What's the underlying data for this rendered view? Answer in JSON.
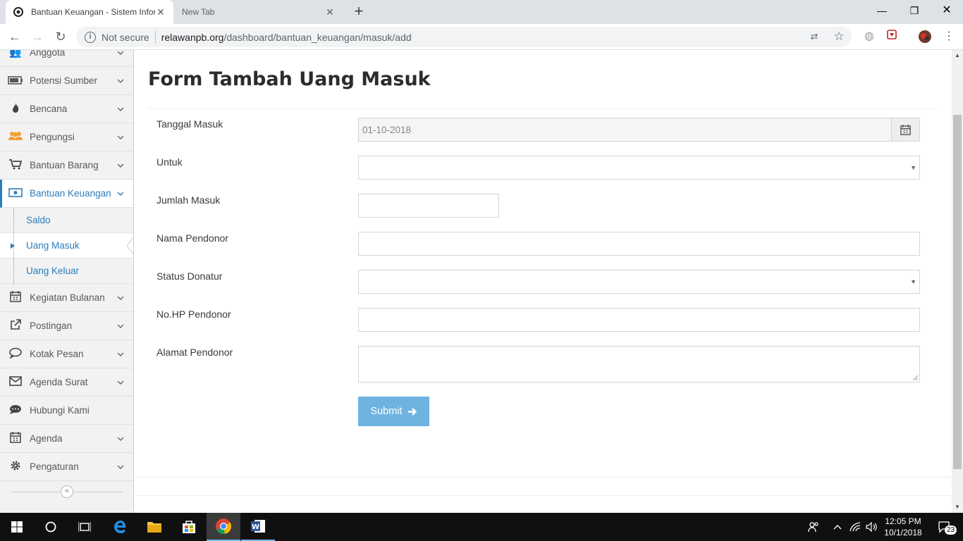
{
  "browser": {
    "tabs": [
      {
        "title": "Bantuan Keuangan - Sistem Infor",
        "active": true
      },
      {
        "title": "New Tab",
        "active": false
      }
    ],
    "security_label": "Not secure",
    "url_host": "relawanpb.org",
    "url_path": "/dashboard/bantuan_keuangan/masuk/add"
  },
  "sidebar": {
    "items": [
      {
        "label": "Anggota",
        "icon": "users-icon"
      },
      {
        "label": "Potensi Sumber",
        "icon": "battery-icon"
      },
      {
        "label": "Bencana",
        "icon": "fire-icon"
      },
      {
        "label": "Pengungsi",
        "icon": "group-icon"
      },
      {
        "label": "Bantuan Barang",
        "icon": "cart-icon"
      },
      {
        "label": "Bantuan Keuangan",
        "icon": "money-icon"
      },
      {
        "label": "Kegiatan Bulanan",
        "icon": "calendar-icon"
      },
      {
        "label": "Postingan",
        "icon": "external-link-icon"
      },
      {
        "label": "Kotak Pesan",
        "icon": "chat-icon"
      },
      {
        "label": "Agenda Surat",
        "icon": "envelope-icon"
      },
      {
        "label": "Hubungi Kami",
        "icon": "comment-icon"
      },
      {
        "label": "Agenda",
        "icon": "calendar-icon"
      },
      {
        "label": "Pengaturan",
        "icon": "gear-icon"
      }
    ],
    "submenu": [
      {
        "label": "Saldo"
      },
      {
        "label": "Uang Masuk"
      },
      {
        "label": "Uang Keluar"
      }
    ]
  },
  "form": {
    "title": "Form Tambah Uang Masuk",
    "fields": {
      "tanggal_label": "Tanggal Masuk",
      "tanggal_value": "01-10-2018",
      "untuk_label": "Untuk",
      "jumlah_label": "Jumlah Masuk",
      "nama_label": "Nama Pendonor",
      "status_label": "Status Donatur",
      "nohp_label": "No.HP Pendonor",
      "alamat_label": "Alamat Pendonor"
    },
    "submit_label": "Submit"
  },
  "taskbar": {
    "time": "12:05 PM",
    "date": "10/1/2018",
    "notification_count": "23"
  },
  "colors": {
    "accent": "#2b7dbc",
    "submit": "#6fb3e0",
    "sidebar_bg": "#f2f2f2"
  }
}
